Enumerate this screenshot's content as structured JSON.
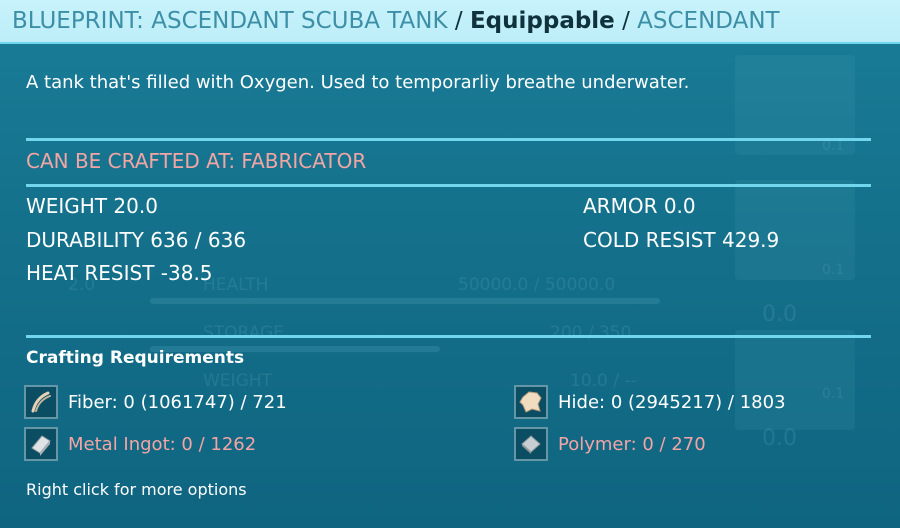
{
  "title": {
    "name": "BLUEPRINT: ASCENDANT SCUBA TANK",
    "separator1": "/",
    "type": "Equippable",
    "separator2": "/",
    "quality": "ASCENDANT"
  },
  "description": "A tank that's filled with Oxygen. Used to temporarliy breathe underwater.",
  "crafted_at": "CAN BE CRAFTED AT: FABRICATOR",
  "stats": {
    "weight": "WEIGHT 20.0",
    "durability": "DURABILITY 636 / 636",
    "heat_resist": "HEAT RESIST -38.5",
    "armor": "ARMOR 0.0",
    "cold_resist": "COLD RESIST 429.9"
  },
  "requirements": {
    "title": "Crafting Requirements",
    "items": [
      {
        "text": "Fiber: 0 (1061747) / 721",
        "icon": "fiber-icon",
        "met": true
      },
      {
        "text": "Hide: 0 (2945217) / 1803",
        "icon": "hide-icon",
        "met": true
      },
      {
        "text": "Metal Ingot: 0 / 1262",
        "icon": "metal-ingot-icon",
        "met": false
      },
      {
        "text": "Polymer: 0 / 270",
        "icon": "polymer-icon",
        "met": false
      }
    ]
  },
  "hint": "Right click for more options",
  "background": {
    "health_label": "HEALTH",
    "health_value": "50000.0 / 50000.0",
    "storage_label": "STORAGE",
    "storage_value": "200 / 350",
    "weight_label": "WEIGHT",
    "weight_value": "10.0 / --",
    "armor_val_1": "0.0",
    "armor_val_2": "0.0",
    "slot_val_1": "0.1",
    "slot_val_2": "0.1",
    "slot_val_3": "0.1",
    "level_val": "2.0"
  },
  "colors": {
    "title_bg": "#c7f2fb",
    "title_text": "#3c8fa6",
    "panel_bg": "#1a7d98",
    "divider": "#72d7ec",
    "warning_text": "#f3a5a5"
  }
}
